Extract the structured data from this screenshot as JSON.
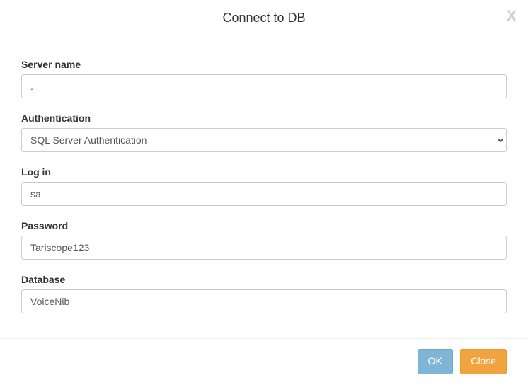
{
  "dialog": {
    "title": "Connect to DB",
    "close_glyph": "X"
  },
  "form": {
    "server_name": {
      "label": "Server name",
      "value": "."
    },
    "authentication": {
      "label": "Authentication",
      "selected": "SQL Server Authentication"
    },
    "login": {
      "label": "Log in",
      "value": "sa"
    },
    "password": {
      "label": "Password",
      "value": "Tariscope123"
    },
    "database": {
      "label": "Database",
      "value": "VoiceNib"
    }
  },
  "footer": {
    "ok_label": "OK",
    "close_label": "Close"
  }
}
